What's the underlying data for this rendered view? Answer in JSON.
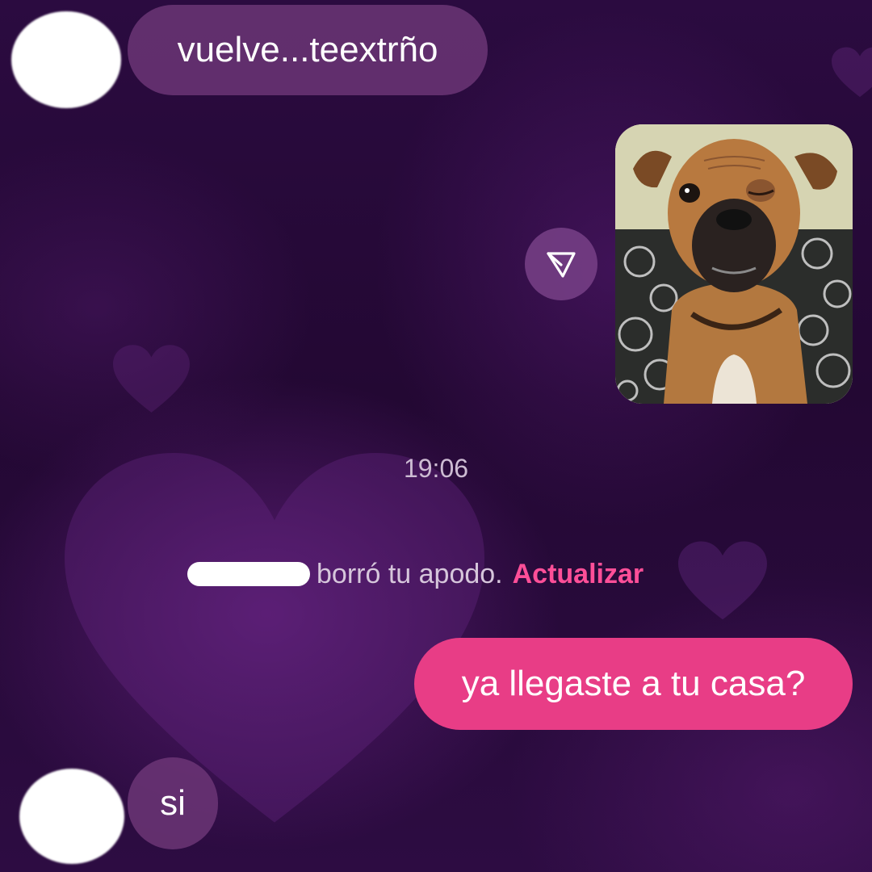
{
  "messages": {
    "received_1": "vuelve...teextrño",
    "timestamp": "19:06",
    "notice_text": "borró tu apodo.",
    "notice_action": "Actualizar",
    "sent_1": "ya llegaste a tu casa?",
    "received_2": "si"
  },
  "icons": {
    "share": "send-triangle-icon",
    "photo": "boxer-dog-photo"
  },
  "colors": {
    "sent_bubble": "#e83d86",
    "received_bubble": "#6e3778",
    "notice_action": "#ff4f98",
    "background": "#2a0b3e"
  }
}
